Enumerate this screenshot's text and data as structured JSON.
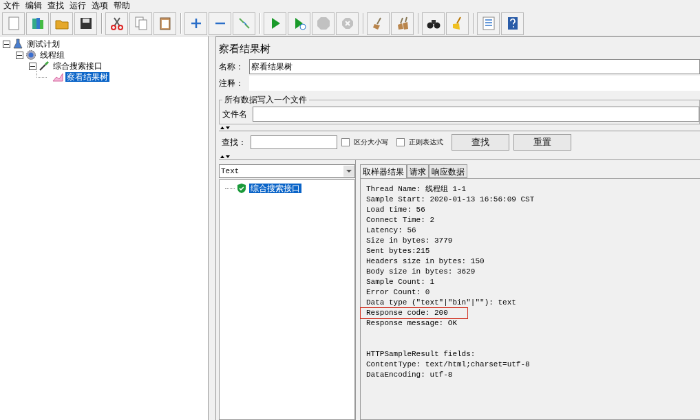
{
  "menu": [
    "文件",
    "编辑",
    "查找",
    "运行",
    "选项",
    "帮助"
  ],
  "toolbar": [
    [
      {
        "kind": "new",
        "disabled": false
      },
      {
        "kind": "templates",
        "disabled": false
      },
      {
        "kind": "open",
        "disabled": false
      },
      {
        "kind": "save",
        "disabled": false
      }
    ],
    [
      {
        "kind": "cut",
        "disabled": false
      },
      {
        "kind": "copy",
        "disabled": false
      },
      {
        "kind": "paste",
        "disabled": false
      }
    ],
    [
      {
        "kind": "expand",
        "disabled": false
      },
      {
        "kind": "collapse",
        "disabled": false
      },
      {
        "kind": "toggle",
        "disabled": false
      }
    ],
    [
      {
        "kind": "start",
        "disabled": false
      },
      {
        "kind": "start-no-timers",
        "disabled": false
      },
      {
        "kind": "stop",
        "disabled": true
      },
      {
        "kind": "shutdown",
        "disabled": true
      }
    ],
    [
      {
        "kind": "clear",
        "disabled": false
      },
      {
        "kind": "clear-all",
        "disabled": false
      }
    ],
    [
      {
        "kind": "search",
        "disabled": false
      },
      {
        "kind": "reset-search",
        "disabled": false
      }
    ],
    [
      {
        "kind": "function-helper",
        "disabled": false
      },
      {
        "kind": "help",
        "disabled": false
      }
    ]
  ],
  "tree": [
    {
      "label": "测试计划",
      "kind": "flask",
      "expanded": true,
      "selected": false,
      "children": [
        {
          "label": "线程组",
          "kind": "gear",
          "expanded": true,
          "selected": false,
          "children": [
            {
              "label": "综合搜索接口",
              "kind": "pipette",
              "expanded": true,
              "selected": false,
              "children": [
                {
                  "label": "察看结果树",
                  "kind": "graph",
                  "selected": true
                }
              ]
            }
          ]
        }
      ]
    }
  ],
  "panel": {
    "title": "察看结果树",
    "name": {
      "label": "名称：",
      "value": "察看结果树"
    },
    "comment": {
      "label": "注释："
    },
    "file_group": {
      "legend": "所有数据写入一个文件",
      "label": "文件名"
    },
    "search": {
      "label": "查找：",
      "case_sensitive": {
        "label": "区分大小写",
        "checked": false
      },
      "regex": {
        "label": "正则表达式",
        "checked": false
      },
      "buttons": [
        "查找",
        "重置"
      ]
    },
    "renderer": "Text",
    "samples": [
      {
        "label": "综合搜索接口",
        "kind": "success",
        "selected": true
      }
    ],
    "tabs": [
      {
        "label": "取样器结果",
        "selected": true
      },
      {
        "label": "请求",
        "selected": false
      },
      {
        "label": "响应数据",
        "selected": false
      }
    ],
    "result_lines": [
      {
        "text": "Thread Name: 线程组 1-1",
        "highlighted": false
      },
      {
        "text": "Sample Start: 2020-01-13 16:56:09 CST",
        "highlighted": false
      },
      {
        "text": "Load time: 56",
        "highlighted": false
      },
      {
        "text": "Connect Time: 2",
        "highlighted": false
      },
      {
        "text": "Latency: 56",
        "highlighted": false
      },
      {
        "text": "Size in bytes: 3779",
        "highlighted": false
      },
      {
        "text": "Sent bytes:215",
        "highlighted": false
      },
      {
        "text": "Headers size in bytes: 150",
        "highlighted": false
      },
      {
        "text": "Body size in bytes: 3629",
        "highlighted": false
      },
      {
        "text": "Sample Count: 1",
        "highlighted": false
      },
      {
        "text": "Error Count: 0",
        "highlighted": false
      },
      {
        "text": "Data type (\"text\"|\"bin\"|\"\"): text",
        "highlighted": false
      },
      {
        "text": "Response code: 200",
        "highlighted": true
      },
      {
        "text": "Response message: OK",
        "highlighted": false
      }
    ],
    "field_lines": [
      "HTTPSampleResult fields:",
      "ContentType: text/html;charset=utf-8",
      "DataEncoding: utf-8"
    ]
  }
}
